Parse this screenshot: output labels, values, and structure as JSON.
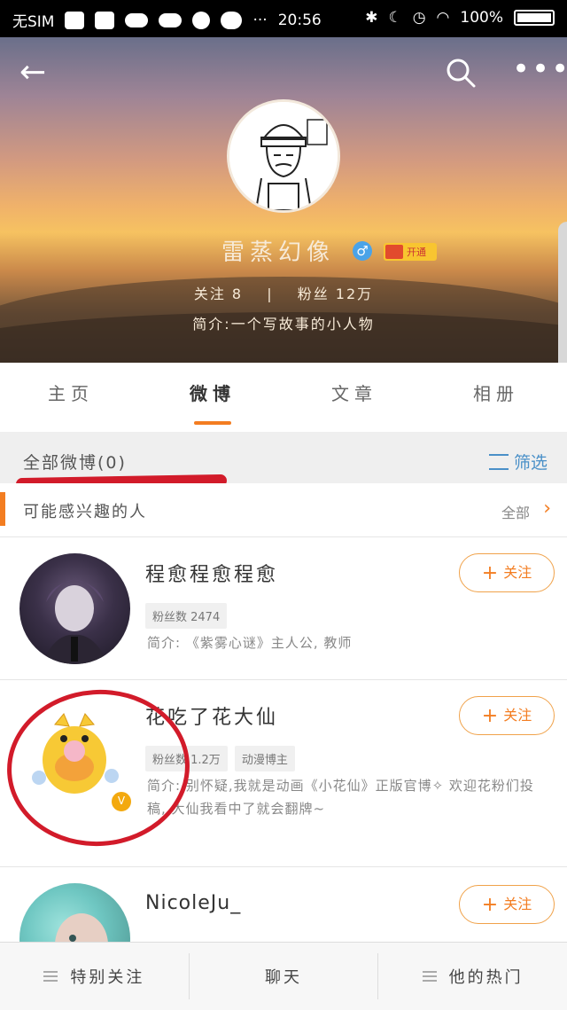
{
  "status_bar": {
    "carrier": "无SIM",
    "dots": "···",
    "time": "20:56",
    "battery": "100%"
  },
  "profile": {
    "name": "雷蒸幻像",
    "gender_symbol": "♂",
    "vip_label": "开通",
    "following_label": "关注",
    "following_count": "8",
    "followers_label": "粉丝",
    "followers_count": "12万",
    "separator": "|",
    "bio": "简介:一个写故事的小人物"
  },
  "tabs": [
    {
      "label": "主页"
    },
    {
      "label": "微博"
    },
    {
      "label": "文章"
    },
    {
      "label": "相册"
    }
  ],
  "section": {
    "title": "全部微博(0)",
    "filter_label": "筛选"
  },
  "interest": {
    "title": "可能感兴趣的人",
    "all_label": "全部"
  },
  "users": [
    {
      "name": "程愈程愈程愈",
      "follow_label": "关注",
      "chips": [
        "粉丝数 2474"
      ],
      "desc": "简介: 《紫雾心谜》主人公, 教师"
    },
    {
      "name": "花吃了花大仙",
      "follow_label": "关注",
      "chips": [
        "粉丝数 1.2万",
        "动漫博主"
      ],
      "desc": "简介: 别怀疑,我就是动画《小花仙》正版官博✧ 欢迎花粉们投稿, 大仙我看中了就会翻牌~"
    },
    {
      "name": "NicoleJu_",
      "follow_label": "关注",
      "chips": [],
      "desc": ""
    }
  ],
  "bottom_bar": [
    {
      "label": "特别关注"
    },
    {
      "label": "聊天"
    },
    {
      "label": "他的热门"
    }
  ],
  "colors": {
    "accent": "#f37d21",
    "annotation_red": "#d21b2a",
    "filter_blue": "#4a90c8"
  }
}
